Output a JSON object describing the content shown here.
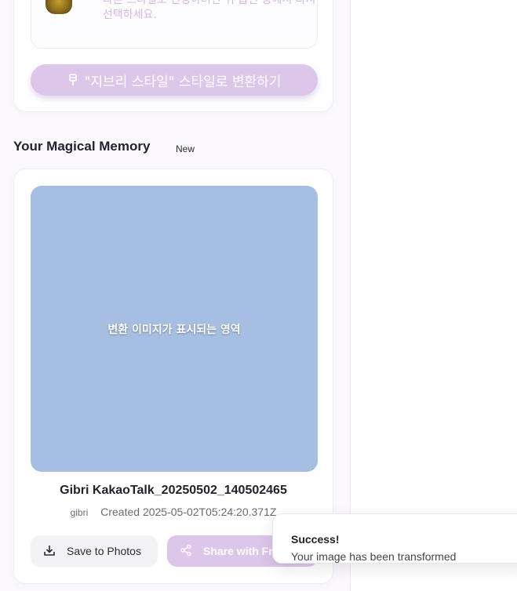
{
  "style_panel": {
    "hint_text": "다른 스타일로 변경하려면 위 옵션 중에서 다시 선택하세요.",
    "convert_button_label": "\"지브리 스타일\" 스타일로 변환하기"
  },
  "memory_section": {
    "title": "Your Magical Memory",
    "badge": "New",
    "image_alt": "변환 이미지가 표시되는 영역",
    "image_title": "Gibri KakaoTalk_20250502_140502465",
    "style_tag": "gibri",
    "created": "Created 2025-05-02T05:24:20.371Z",
    "save_button_label": "Save to Photos",
    "share_button_label": "Share with Friends"
  },
  "toast": {
    "title": "Success!",
    "message": "Your image has been transformed"
  },
  "colors": {
    "accent": "#dcc6ea",
    "image_placeholder": "#a6bee1",
    "hint_text": "#d3b9e4"
  }
}
